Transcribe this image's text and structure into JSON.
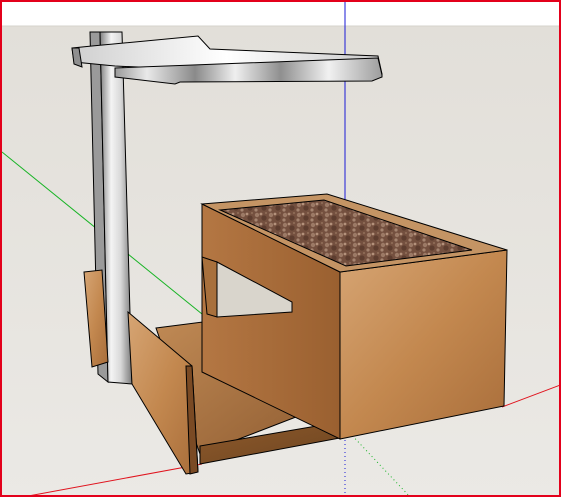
{
  "viewport": {
    "frame_color": "#e3001b",
    "sky_color": "#ffffff",
    "ground_color": "#e6e4df"
  },
  "axes": {
    "red_axis_color": "#e0141e",
    "green_axis_color": "#19b426",
    "blue_axis_color": "#1a1ad6"
  },
  "model": {
    "wood_color": "#b97a45",
    "wood_light": "#d5a06e",
    "wood_dark": "#8c5a2e",
    "edge_color": "#000000",
    "lamp_metal_light": "#f3f3f3",
    "lamp_metal_dark": "#8d8d8d",
    "soil_color": "#6e4b3c"
  }
}
